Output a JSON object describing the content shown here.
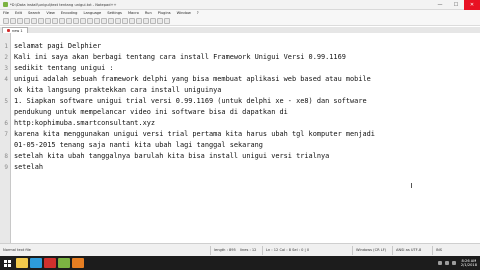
{
  "window": {
    "title": "*D:\\Data install\\unigui\\text tentang unigui.txt - Notepad++",
    "controls": {
      "minimize": "—",
      "maximize": "☐",
      "close": "✕"
    }
  },
  "menu": [
    "File",
    "Edit",
    "Search",
    "View",
    "Encoding",
    "Language",
    "Settings",
    "Macro",
    "Run",
    "Plugins",
    "Window",
    "?"
  ],
  "tab": {
    "label": "new 1"
  },
  "editor": {
    "lines": [
      {
        "num": "1",
        "text": "selamat pagi Delphier"
      },
      {
        "num": "2",
        "text": "Kali ini saya akan berbagi tentang cara install Framework Unigui Versi 0.99.1169"
      },
      {
        "num": "3",
        "text": "sedikit tentang unigui :"
      },
      {
        "num": "4",
        "text": "unigui adalah sebuah framework delphi yang bisa membuat aplikasi web based atau mobile"
      },
      {
        "num": "",
        "text": "ok kita langsung praktekkan cara install uniguinya"
      },
      {
        "num": "5",
        "text": "1. Siapkan software unigui trial versi 0.99.1169 (untuk delphi xe - xe8) dan software"
      },
      {
        "num": "",
        "text": "pendukung untuk mempelancar video ini software bisa di dapatkan di"
      },
      {
        "num": "6",
        "text": "http:kophimuba.smartconsultant.xyz"
      },
      {
        "num": "7",
        "text": "karena kita menggunakan unigui versi trial pertama kita harus ubah tgl komputer menjadi"
      },
      {
        "num": "",
        "text": "01-05-2015 tenang saja nanti kita ubah lagi tanggal sekarang"
      },
      {
        "num": "8",
        "text": "setelah kita ubah tanggalnya barulah kita bisa install unigui versi trialnya"
      },
      {
        "num": "9",
        "text": "setelah"
      }
    ]
  },
  "status": {
    "file_type": "Normal text file",
    "length": "length : 895",
    "lines": "lines : 12",
    "position": "Ln : 12   Col : 8   Sel : 0 | 0",
    "eol": "Windows (CR LF)",
    "encoding": "ANSI as UTF-8",
    "mode": "INS"
  },
  "taskbar": {
    "apps": [
      {
        "name": "file-explorer",
        "color": "#f2c94c"
      },
      {
        "name": "browser",
        "color": "#2d9cdb"
      },
      {
        "name": "delphi",
        "color": "#d0312d"
      },
      {
        "name": "notepad-plus-plus",
        "color": "#7cb342"
      },
      {
        "name": "recorder",
        "color": "#e67e22"
      }
    ],
    "time": "8:26 AM",
    "date": "2/1/2018"
  }
}
